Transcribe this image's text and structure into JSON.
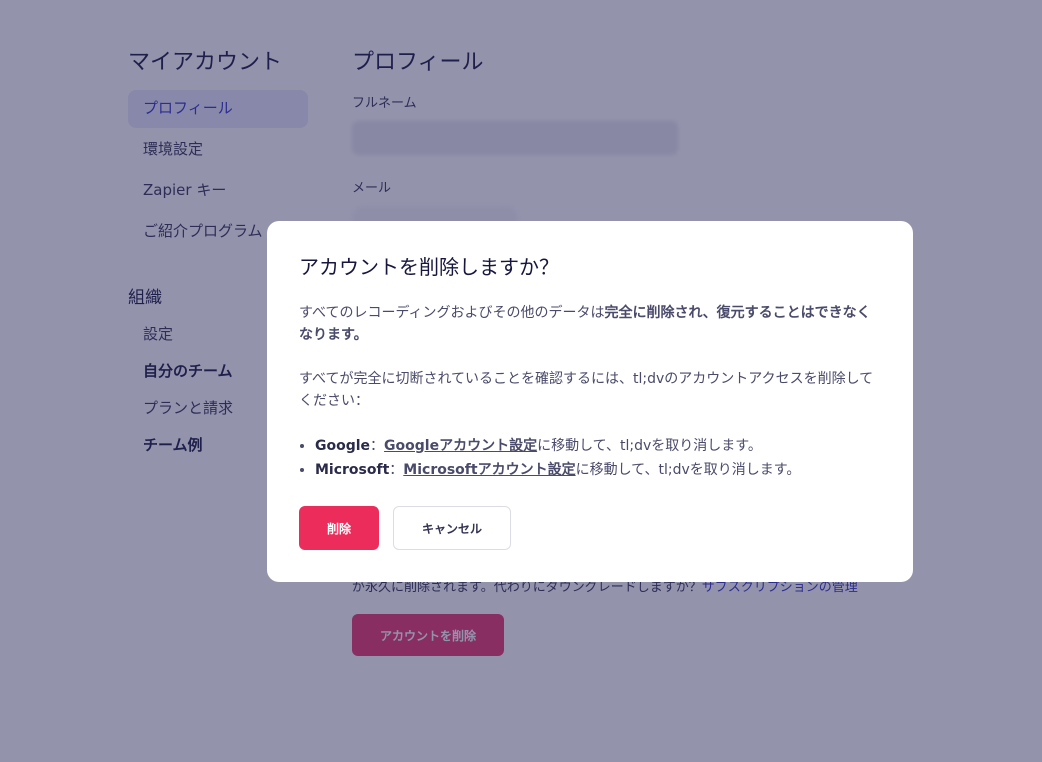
{
  "sidebar": {
    "title": "マイアカウント",
    "items": [
      {
        "label": "プロフィール"
      },
      {
        "label": "環境設定"
      },
      {
        "label": "Zapier キー"
      },
      {
        "label": "ご紹介プログラム"
      }
    ],
    "org_title": "組織",
    "org_items": [
      {
        "label": "設定"
      },
      {
        "label": "自分のチーム"
      },
      {
        "label": "プランと請求"
      },
      {
        "label": "チーム例"
      }
    ]
  },
  "main": {
    "title": "プロフィール",
    "fullname_label": "フルネーム",
    "email_label": "メール",
    "danger_text": "が永久に削除されます。代わりにダウングレードしますか？",
    "danger_link": "サブスクリプションの管理",
    "delete_account_button": "アカウントを削除"
  },
  "modal": {
    "title": "アカウントを削除しますか？",
    "para1_normal": "すべてのレコーディングおよびその他のデータは",
    "para1_bold": "完全に削除され、復元することはできなくなります。",
    "para2": "すべてが完全に切断されていることを確認するには、tl;dvのアカウントアクセスを削除してください：",
    "google_label": "Google",
    "separator": "：",
    "google_link": "Googleアカウント設定",
    "google_suffix": "に移動して、tl;dvを取り消します。",
    "microsoft_label": "Microsoft",
    "microsoft_link": "Microsoftアカウント設定",
    "microsoft_suffix": "に移動して、tl;dvを取り消します。",
    "delete_button": "削除",
    "cancel_button": "キャンセル"
  },
  "colors": {
    "accent": "#3030c8",
    "danger": "#ec2d5c",
    "overlay": "#28285a"
  }
}
